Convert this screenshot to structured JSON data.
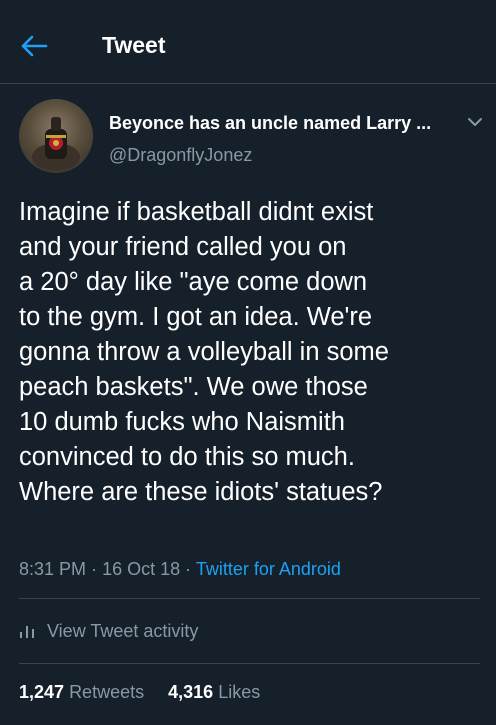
{
  "header": {
    "title": "Tweet",
    "back_icon": "arrow-left-icon"
  },
  "colors": {
    "background": "#15202b",
    "accent": "#1da1f2",
    "secondary_text": "#8899a6",
    "divider": "#38444d"
  },
  "tweet": {
    "display_name": "Beyonce has an uncle named Larry ...",
    "handle": "@DragonflyJonez",
    "text_lines": [
      "Imagine if basketball didnt exist",
      "and your friend called you on",
      "a 20° day like \"aye come down",
      "to the gym. I got an idea. We're",
      "gonna throw a volleyball in some",
      "peach baskets\". We owe those",
      "10 dumb fucks who Naismith",
      "convinced to do this so much.",
      "Where are these idiots' statues?"
    ],
    "time": "8:31 PM",
    "date": "16 Oct 18",
    "separator": "·",
    "source": "Twitter for Android"
  },
  "activity": {
    "label": "View Tweet activity",
    "icon": "bar-chart-icon"
  },
  "stats": {
    "retweets_count": "1,247",
    "retweets_label": "Retweets",
    "likes_count": "4,316",
    "likes_label": "Likes"
  }
}
